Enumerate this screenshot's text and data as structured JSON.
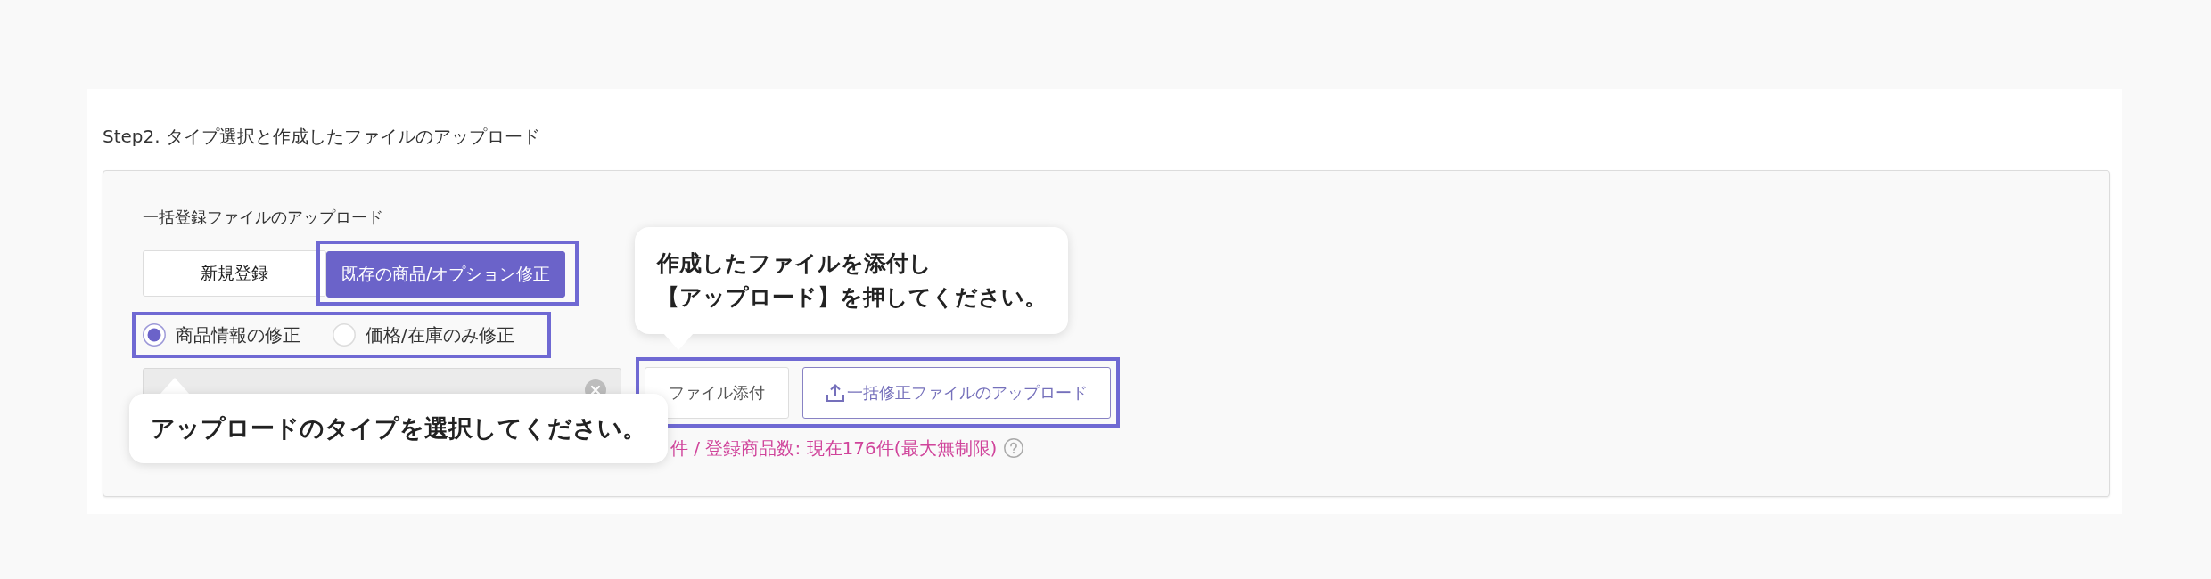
{
  "section": {
    "title": "Step2. タイプ選択と作成したファイルのアップロード"
  },
  "upload_panel": {
    "label": "一括登録ファイルのアップロード",
    "mode_buttons": [
      {
        "label": "新規登録",
        "selected": false,
        "highlighted": false
      },
      {
        "label": "既存の商品/オプション修正",
        "selected": true,
        "highlighted": true
      }
    ],
    "radio_group": {
      "highlighted": true,
      "options": [
        {
          "label": "商品情報の修正",
          "selected": true
        },
        {
          "label": "価格/在庫のみ修正",
          "selected": false
        }
      ]
    },
    "file_field": {
      "disabled": true
    },
    "file_actions": {
      "highlighted": true,
      "buttons": [
        {
          "kind": "attach",
          "label": "ファイル添付"
        },
        {
          "kind": "upload",
          "label": "一括修正ファイルのアップロード"
        }
      ]
    },
    "note": "件 / 登録商品数: 現在176件(最大無制限)"
  },
  "tooltips": [
    {
      "kind": "downward",
      "lines": [
        "作成したファイルを添付し",
        "【アップロード】を押してください。"
      ]
    },
    {
      "kind": "upward",
      "lines": [
        "アップロードのタイプを選択してください。"
      ]
    }
  ]
}
